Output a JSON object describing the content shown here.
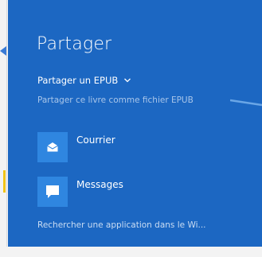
{
  "panel": {
    "title": "Partager",
    "share_type": "Partager un EPUB",
    "share_description": "Partager ce livre comme fichier EPUB",
    "apps": [
      {
        "label": "Courrier",
        "icon": "mail-icon"
      },
      {
        "label": "Messages",
        "icon": "messages-icon"
      }
    ],
    "search_store": "Rechercher une application dans le Wi..."
  },
  "colors": {
    "panel_bg": "#1c67c2",
    "app_tile": "#2f86e0",
    "description_text": "#a9c6ea"
  }
}
